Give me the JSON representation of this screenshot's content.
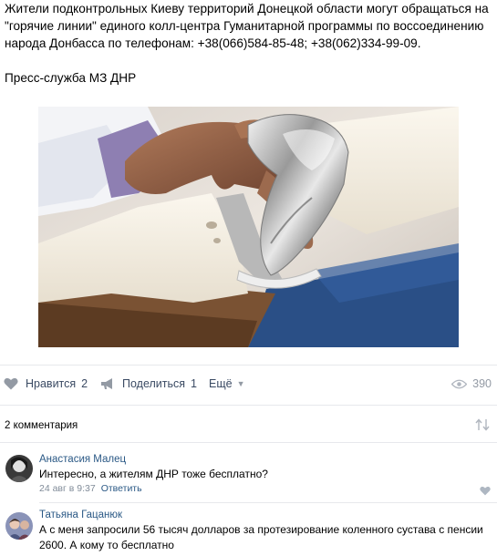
{
  "post": {
    "text": "Жители подконтрольных Киеву территорий Донецкой области могут обращаться на \"горячие линии\" единого колл-центра Гуманитарной программы по воссоединению народа Донбасса по телефонам: +38(066)584-85-48; +38(062)334-99-09.",
    "signature": "Пресс-служба МЗ ДНР"
  },
  "actions": {
    "like_label": "Нравится",
    "like_count": "2",
    "share_label": "Поделиться",
    "share_count": "1",
    "more_label": "Ещё",
    "views_count": "390"
  },
  "comments_header": "2 комментария",
  "comments": [
    {
      "author": "Анастасия Малец",
      "text": "Интересно, а жителям ДНР тоже бесплатно?",
      "date": "24 авг в 9:37",
      "reply_label": "Ответить"
    },
    {
      "author": "Татьяна Гацанюк",
      "text": "А с меня запросили 56 тысяч долларов за протезирование коленного сустава с пенсии 2600. А кому то бесплатно"
    }
  ],
  "colors": {
    "link": "#2a5885",
    "action_text": "#3a4a63",
    "meta_text": "#818c99",
    "icon": "#939aa4",
    "divider": "#e7e8ec"
  },
  "icons": [
    "heart-icon",
    "megaphone-icon",
    "eye-icon",
    "sort-icon",
    "chevron-down-icon"
  ]
}
